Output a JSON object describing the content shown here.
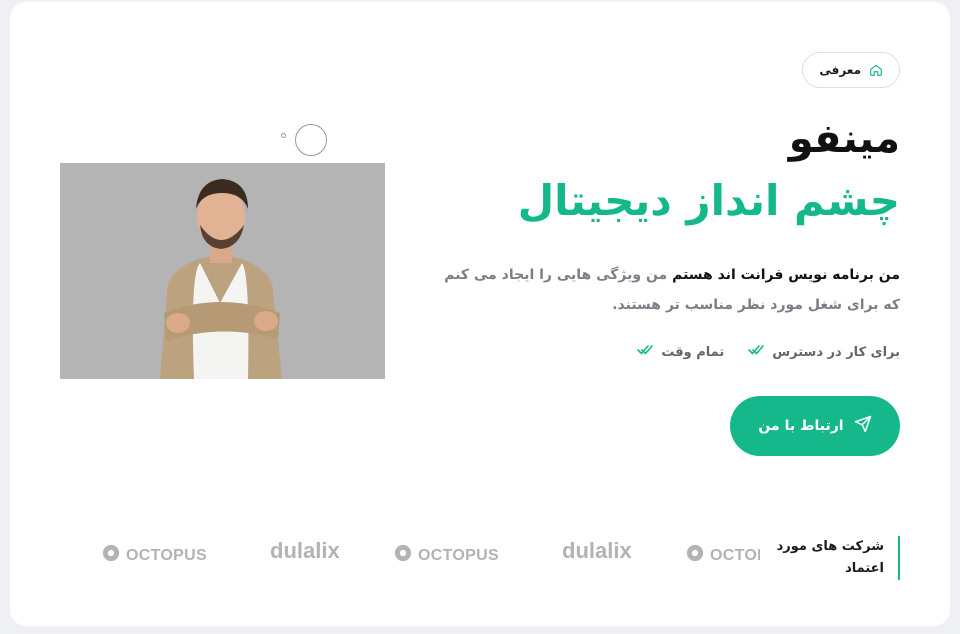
{
  "breadcrumb": {
    "label": "معرفی",
    "icon": "home-icon"
  },
  "hero": {
    "name": "مینفو",
    "tagline": "چشم انداز دیجیتال",
    "desc_strong": "من برنامه نویس فرانت اند هستم",
    "desc_rest": " من ویژگی هایی را ایجاد می کنم که برای شغل مورد نظر مناسب تر هستند.",
    "features": [
      "برای کار در دسترس",
      "تمام وقت"
    ],
    "cta_label": "ارتباط با من"
  },
  "trusted": {
    "title": "شرکت های مورد اعتماد",
    "logos": [
      "OCTOPUS",
      "dulalix",
      "OCTOPUS",
      "dulalix",
      "OCTOPUS"
    ]
  },
  "colors": {
    "accent": "#14b88a",
    "background": "#eef0f3",
    "card": "#ffffff"
  }
}
